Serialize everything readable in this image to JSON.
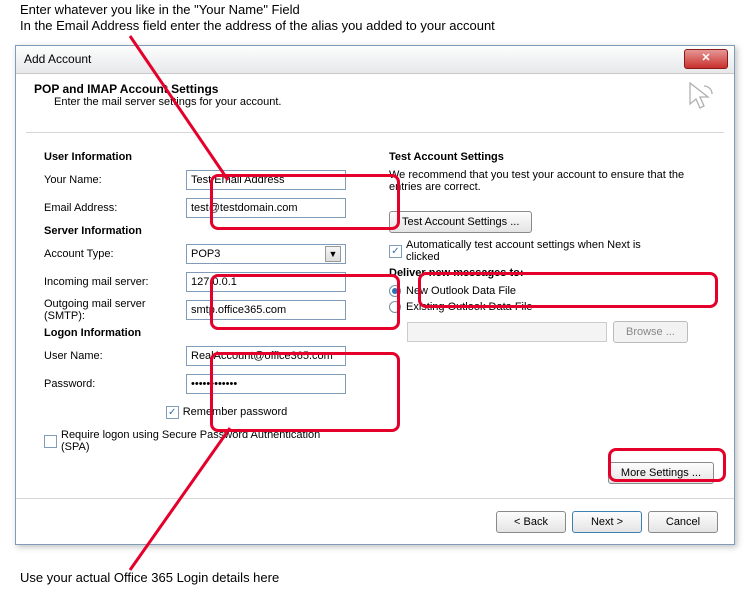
{
  "instructions": {
    "line1": "Enter whatever you like in the \"Your Name\" Field",
    "line2": "In the Email Address field enter the address of the alias you added to your account",
    "line3": "Use your actual Office 365 Login details here"
  },
  "dialog": {
    "title": "Add Account",
    "close": "✕",
    "heading": "POP and IMAP Account Settings",
    "subheading": "Enter the mail server settings for your account."
  },
  "left": {
    "user_info_title": "User Information",
    "your_name_label": "Your Name:",
    "your_name_value": "Test Email Address",
    "email_label": "Email Address:",
    "email_value": "test@testdomain.com",
    "server_info_title": "Server Information",
    "account_type_label": "Account Type:",
    "account_type_value": "POP3",
    "incoming_label": "Incoming mail server:",
    "incoming_value": "127.0.0.1",
    "outgoing_label": "Outgoing mail server (SMTP):",
    "outgoing_value": "smtp.office365.com",
    "logon_title": "Logon Information",
    "username_label": "User Name:",
    "username_value": "RealAccount@office365.com",
    "password_label": "Password:",
    "password_value": "************",
    "remember_password": "Remember password",
    "spa_label": "Require logon using Secure Password Authentication (SPA)"
  },
  "right": {
    "test_title": "Test Account Settings",
    "test_text": "We recommend that you test your account to ensure that the entries are correct.",
    "test_button": "Test Account Settings ...",
    "auto_test": "Automatically test account settings when Next is clicked",
    "deliver_title": "Deliver new messages to:",
    "radio_new": "New Outlook Data File",
    "radio_existing": "Existing Outlook Data File",
    "browse": "Browse ...",
    "more_settings": "More Settings ..."
  },
  "footer": {
    "back": "< Back",
    "next": "Next >",
    "cancel": "Cancel"
  }
}
